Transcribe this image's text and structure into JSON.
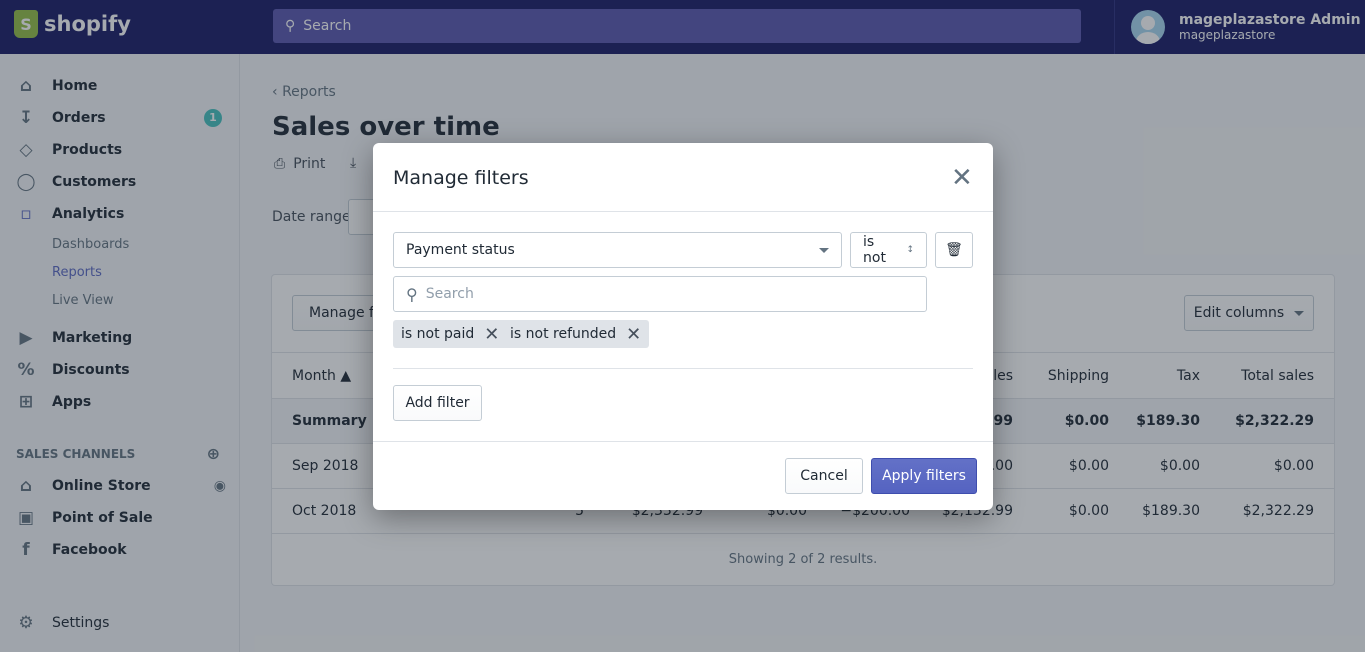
{
  "topbar": {
    "brand": "shopify",
    "search_placeholder": "Search",
    "user_name": "mageplazastore Admin",
    "store_name": "mageplazastore"
  },
  "sidebar": {
    "items": [
      {
        "label": "Home",
        "icon": "home-icon"
      },
      {
        "label": "Orders",
        "icon": "orders-icon",
        "badge": "1"
      },
      {
        "label": "Products",
        "icon": "tag-icon"
      },
      {
        "label": "Customers",
        "icon": "person-icon"
      },
      {
        "label": "Analytics",
        "icon": "bar-chart-icon"
      },
      {
        "label": "Marketing",
        "icon": "megaphone-icon"
      },
      {
        "label": "Discounts",
        "icon": "discount-icon"
      },
      {
        "label": "Apps",
        "icon": "apps-icon"
      }
    ],
    "analytics_sub": [
      "Dashboards",
      "Reports",
      "Live View"
    ],
    "sales_channels_heading": "SALES CHANNELS",
    "channels": [
      {
        "label": "Online Store",
        "icon": "store-icon"
      },
      {
        "label": "Point of Sale",
        "icon": "pos-icon"
      },
      {
        "label": "Facebook",
        "icon": "facebook-icon"
      }
    ],
    "settings": "Settings",
    "accent": "#5c6ac4"
  },
  "page": {
    "breadcrumb": "Reports",
    "title": "Sales over time",
    "print": "Print",
    "date_range_label": "Date range"
  },
  "report": {
    "manage_filters": "Manage filters",
    "edit_columns": "Edit columns",
    "headers": {
      "month": "Month",
      "net_sales": "Net sales",
      "shipping": "Shipping",
      "tax": "Tax",
      "total_sales": "Total sales"
    },
    "rows": [
      {
        "month": "Summary",
        "net_sales": "$2,132.99",
        "shipping": "$0.00",
        "tax": "$189.30",
        "total_sales": "$2,322.29"
      },
      {
        "month": "Sep 2018",
        "net_sales": "$0.00",
        "shipping": "$0.00",
        "tax": "$0.00",
        "total_sales": "$0.00"
      },
      {
        "month": "Oct 2018",
        "orders": "5",
        "gross_sales": "$2,332.99",
        "discounts": "$0.00",
        "returns": "−$200.00",
        "net_sales": "$2,132.99",
        "shipping": "$0.00",
        "tax": "$189.30",
        "total_sales": "$2,322.29"
      }
    ],
    "footer": "Showing 2 of 2 results."
  },
  "modal": {
    "title": "Manage filters",
    "filter_field": "Payment status",
    "operator": "is not",
    "search_placeholder": "Search",
    "tags": [
      "is not paid",
      "is not refunded"
    ],
    "add_filter": "Add filter",
    "cancel": "Cancel",
    "apply": "Apply filters"
  }
}
